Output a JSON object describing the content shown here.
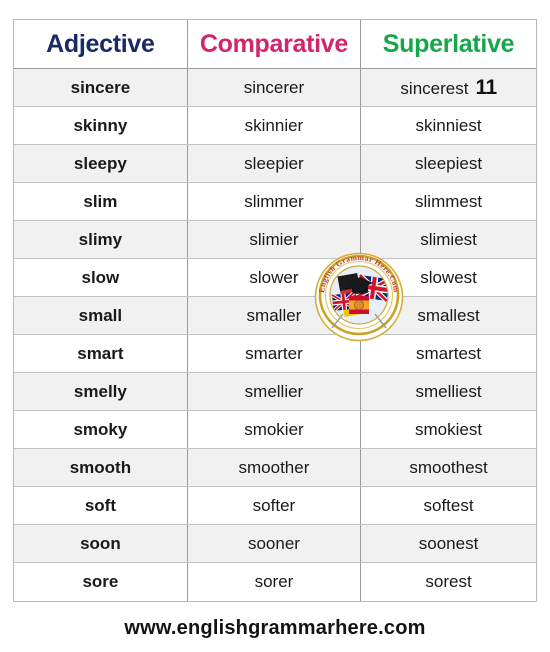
{
  "table": {
    "headers": {
      "adjective": "Adjective",
      "comparative": "Comparative",
      "superlative": "Superlative"
    },
    "header_colors": {
      "adjective": "#1b2a63",
      "comparative": "#d1256d",
      "superlative": "#18a64a"
    },
    "rows": [
      {
        "adjective": "sincere",
        "comparative": "sincerer",
        "superlative": "sincerest",
        "page_marker": "11"
      },
      {
        "adjective": "skinny",
        "comparative": "skinnier",
        "superlative": "skinniest"
      },
      {
        "adjective": "sleepy",
        "comparative": "sleepier",
        "superlative": "sleepiest"
      },
      {
        "adjective": "slim",
        "comparative": "slimmer",
        "superlative": "slimmest"
      },
      {
        "adjective": "slimy",
        "comparative": "slimier",
        "superlative": "slimiest"
      },
      {
        "adjective": "slow",
        "comparative": "slower",
        "superlative": "slowest"
      },
      {
        "adjective": "small",
        "comparative": "smaller",
        "superlative": "smallest"
      },
      {
        "adjective": "smart",
        "comparative": "smarter",
        "superlative": "smartest"
      },
      {
        "adjective": "smelly",
        "comparative": "smellier",
        "superlative": "smelliest"
      },
      {
        "adjective": "smoky",
        "comparative": "smokier",
        "superlative": "smokiest"
      },
      {
        "adjective": "smooth",
        "comparative": "smoother",
        "superlative": "smoothest"
      },
      {
        "adjective": "soft",
        "comparative": "softer",
        "superlative": "softest"
      },
      {
        "adjective": "soon",
        "comparative": "sooner",
        "superlative": "soonest"
      },
      {
        "adjective": "sore",
        "comparative": "sorer",
        "superlative": "sorest"
      }
    ]
  },
  "watermark": {
    "icon": "english-grammar-here-badge",
    "arc_text": "English Grammar Here.Com",
    "rim_color": "#d4af37",
    "arc_text_color": "#c0392b"
  },
  "footer": {
    "url": "www.englishgrammarhere.com"
  }
}
